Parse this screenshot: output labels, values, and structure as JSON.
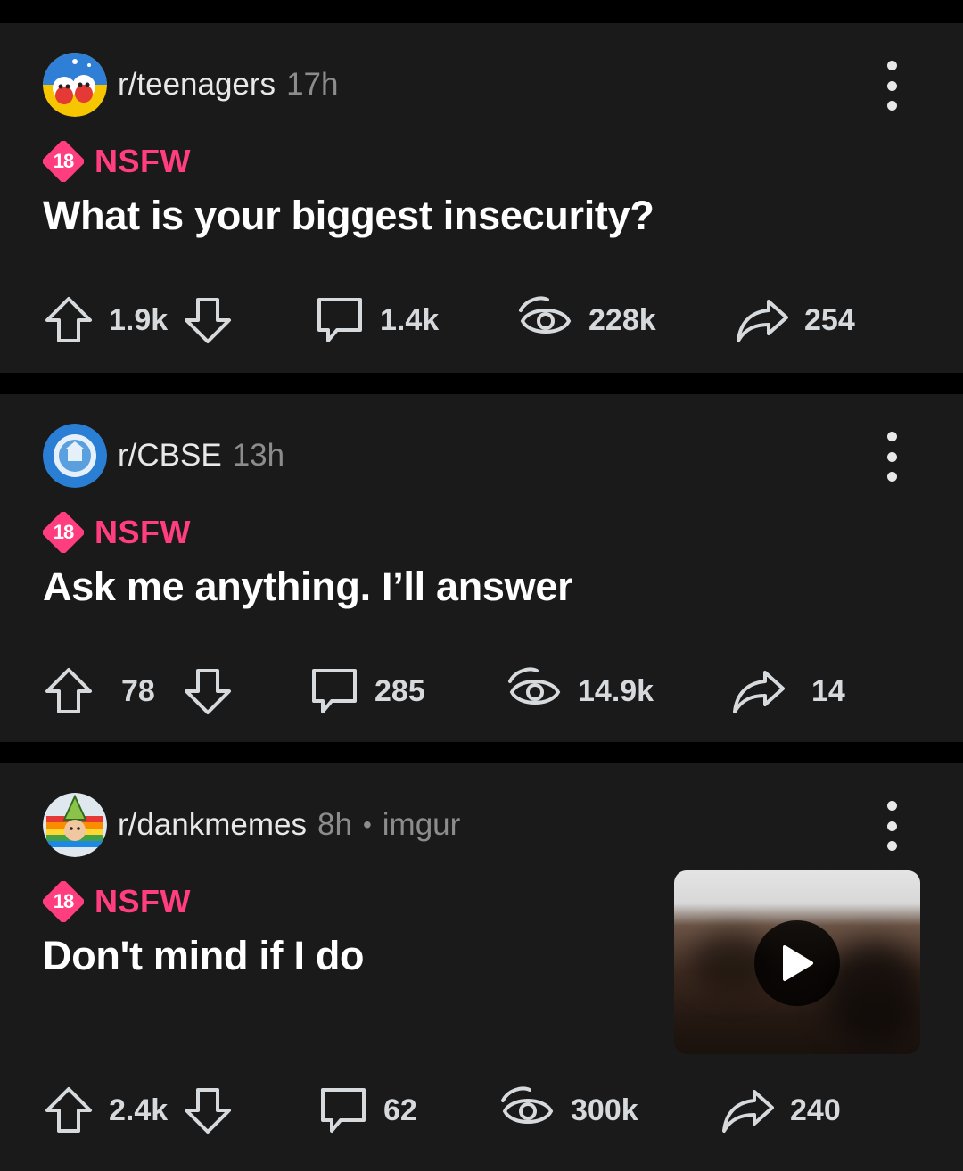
{
  "colors": {
    "background": "#000000",
    "card": "#1a1a1b",
    "nsfw": "#ff3d7f",
    "muted": "#8c8c8c",
    "text": "#ffffff"
  },
  "posts": [
    {
      "subreddit": "r/teenagers",
      "age": "17h",
      "domain": "",
      "nsfw_badge": "18",
      "nsfw_label": "NSFW",
      "title": "What is your biggest insecurity?",
      "upvotes": "1.9k",
      "comments": "1.4k",
      "views": "228k",
      "shares": "254",
      "avatar_icon": "teenagers-avatar-icon",
      "has_thumbnail": false
    },
    {
      "subreddit": "r/CBSE",
      "age": "13h",
      "domain": "",
      "nsfw_badge": "18",
      "nsfw_label": "NSFW",
      "title": "Ask me anything. I’ll answer",
      "upvotes": "78",
      "comments": "285",
      "views": "14.9k",
      "shares": "14",
      "avatar_icon": "cbse-avatar-icon",
      "has_thumbnail": false
    },
    {
      "subreddit": "r/dankmemes",
      "age": "8h",
      "domain": "imgur",
      "separator": "•",
      "nsfw_badge": "18",
      "nsfw_label": "NSFW",
      "title": "Don't mind if I do",
      "upvotes": "2.4k",
      "comments": "62",
      "views": "300k",
      "shares": "240",
      "avatar_icon": "dankmemes-avatar-icon",
      "has_thumbnail": true,
      "thumbnail_icon": "play-icon"
    }
  ]
}
